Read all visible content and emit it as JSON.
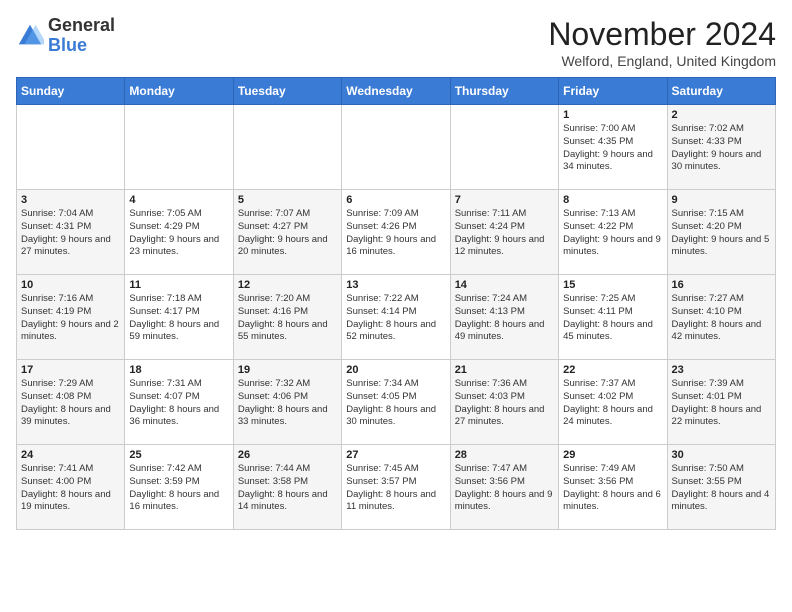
{
  "header": {
    "logo_general": "General",
    "logo_blue": "Blue",
    "month_title": "November 2024",
    "location": "Welford, England, United Kingdom"
  },
  "weekdays": [
    "Sunday",
    "Monday",
    "Tuesday",
    "Wednesday",
    "Thursday",
    "Friday",
    "Saturday"
  ],
  "weeks": [
    [
      {
        "day": "",
        "info": ""
      },
      {
        "day": "",
        "info": ""
      },
      {
        "day": "",
        "info": ""
      },
      {
        "day": "",
        "info": ""
      },
      {
        "day": "",
        "info": ""
      },
      {
        "day": "1",
        "info": "Sunrise: 7:00 AM\nSunset: 4:35 PM\nDaylight: 9 hours\nand 34 minutes."
      },
      {
        "day": "2",
        "info": "Sunrise: 7:02 AM\nSunset: 4:33 PM\nDaylight: 9 hours\nand 30 minutes."
      }
    ],
    [
      {
        "day": "3",
        "info": "Sunrise: 7:04 AM\nSunset: 4:31 PM\nDaylight: 9 hours\nand 27 minutes."
      },
      {
        "day": "4",
        "info": "Sunrise: 7:05 AM\nSunset: 4:29 PM\nDaylight: 9 hours\nand 23 minutes."
      },
      {
        "day": "5",
        "info": "Sunrise: 7:07 AM\nSunset: 4:27 PM\nDaylight: 9 hours\nand 20 minutes."
      },
      {
        "day": "6",
        "info": "Sunrise: 7:09 AM\nSunset: 4:26 PM\nDaylight: 9 hours\nand 16 minutes."
      },
      {
        "day": "7",
        "info": "Sunrise: 7:11 AM\nSunset: 4:24 PM\nDaylight: 9 hours\nand 12 minutes."
      },
      {
        "day": "8",
        "info": "Sunrise: 7:13 AM\nSunset: 4:22 PM\nDaylight: 9 hours\nand 9 minutes."
      },
      {
        "day": "9",
        "info": "Sunrise: 7:15 AM\nSunset: 4:20 PM\nDaylight: 9 hours\nand 5 minutes."
      }
    ],
    [
      {
        "day": "10",
        "info": "Sunrise: 7:16 AM\nSunset: 4:19 PM\nDaylight: 9 hours\nand 2 minutes."
      },
      {
        "day": "11",
        "info": "Sunrise: 7:18 AM\nSunset: 4:17 PM\nDaylight: 8 hours\nand 59 minutes."
      },
      {
        "day": "12",
        "info": "Sunrise: 7:20 AM\nSunset: 4:16 PM\nDaylight: 8 hours\nand 55 minutes."
      },
      {
        "day": "13",
        "info": "Sunrise: 7:22 AM\nSunset: 4:14 PM\nDaylight: 8 hours\nand 52 minutes."
      },
      {
        "day": "14",
        "info": "Sunrise: 7:24 AM\nSunset: 4:13 PM\nDaylight: 8 hours\nand 49 minutes."
      },
      {
        "day": "15",
        "info": "Sunrise: 7:25 AM\nSunset: 4:11 PM\nDaylight: 8 hours\nand 45 minutes."
      },
      {
        "day": "16",
        "info": "Sunrise: 7:27 AM\nSunset: 4:10 PM\nDaylight: 8 hours\nand 42 minutes."
      }
    ],
    [
      {
        "day": "17",
        "info": "Sunrise: 7:29 AM\nSunset: 4:08 PM\nDaylight: 8 hours\nand 39 minutes."
      },
      {
        "day": "18",
        "info": "Sunrise: 7:31 AM\nSunset: 4:07 PM\nDaylight: 8 hours\nand 36 minutes."
      },
      {
        "day": "19",
        "info": "Sunrise: 7:32 AM\nSunset: 4:06 PM\nDaylight: 8 hours\nand 33 minutes."
      },
      {
        "day": "20",
        "info": "Sunrise: 7:34 AM\nSunset: 4:05 PM\nDaylight: 8 hours\nand 30 minutes."
      },
      {
        "day": "21",
        "info": "Sunrise: 7:36 AM\nSunset: 4:03 PM\nDaylight: 8 hours\nand 27 minutes."
      },
      {
        "day": "22",
        "info": "Sunrise: 7:37 AM\nSunset: 4:02 PM\nDaylight: 8 hours\nand 24 minutes."
      },
      {
        "day": "23",
        "info": "Sunrise: 7:39 AM\nSunset: 4:01 PM\nDaylight: 8 hours\nand 22 minutes."
      }
    ],
    [
      {
        "day": "24",
        "info": "Sunrise: 7:41 AM\nSunset: 4:00 PM\nDaylight: 8 hours\nand 19 minutes."
      },
      {
        "day": "25",
        "info": "Sunrise: 7:42 AM\nSunset: 3:59 PM\nDaylight: 8 hours\nand 16 minutes."
      },
      {
        "day": "26",
        "info": "Sunrise: 7:44 AM\nSunset: 3:58 PM\nDaylight: 8 hours\nand 14 minutes."
      },
      {
        "day": "27",
        "info": "Sunrise: 7:45 AM\nSunset: 3:57 PM\nDaylight: 8 hours\nand 11 minutes."
      },
      {
        "day": "28",
        "info": "Sunrise: 7:47 AM\nSunset: 3:56 PM\nDaylight: 8 hours\nand 9 minutes."
      },
      {
        "day": "29",
        "info": "Sunrise: 7:49 AM\nSunset: 3:56 PM\nDaylight: 8 hours\nand 6 minutes."
      },
      {
        "day": "30",
        "info": "Sunrise: 7:50 AM\nSunset: 3:55 PM\nDaylight: 8 hours\nand 4 minutes."
      }
    ]
  ]
}
